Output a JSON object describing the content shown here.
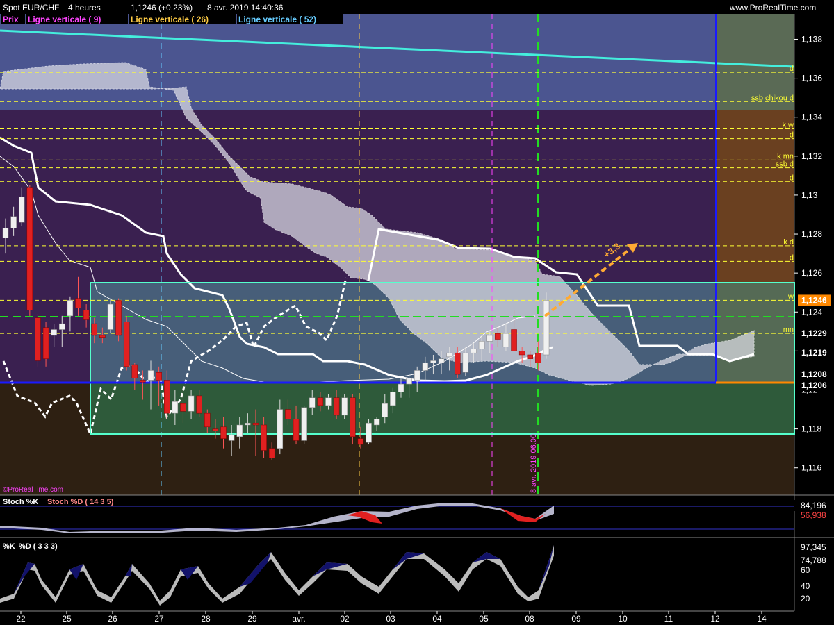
{
  "header": {
    "instrument": "Spot EUR/CHF",
    "timeframe": "4 heures",
    "last": "1,1246 (+0,23%)",
    "datetime": "8 avr. 2019 14:40:36",
    "site": "www.ProRealTime.com",
    "watermark": "©ProRealTime.com"
  },
  "indicators_legend": [
    {
      "label": "Prix",
      "color": "#ff44ff"
    },
    {
      "label": "Ligne verticale ( 9)",
      "color": "#ff44ff"
    },
    {
      "label": "Ligne verticale ( 26)",
      "color": "#ffcc44"
    },
    {
      "label": "Ligne verticale ( 52)",
      "color": "#66ccff"
    }
  ],
  "price_axis": {
    "ticks": [
      "1,138",
      "1,136",
      "1,134",
      "1,132",
      "1,13",
      "1,128",
      "1,126",
      "1,124",
      "1,122",
      "1,12",
      "1,118",
      "1,116"
    ],
    "min": 1.1146,
    "max": 1.1393,
    "highlight": [
      "1,1246",
      "1,1229",
      "1,1219",
      "1,1208",
      "1,1206"
    ]
  },
  "time_axis": [
    "22",
    "25",
    "26",
    "27",
    "28",
    "29",
    "avr.",
    "02",
    "03",
    "04",
    "05",
    "08",
    "09",
    "10",
    "11",
    "12",
    "14"
  ],
  "levels": [
    {
      "label": "d",
      "price": 1.1363
    },
    {
      "label": "ssb chikou d",
      "price": 1.1348
    },
    {
      "label": "k w",
      "price": 1.1334
    },
    {
      "label": "d",
      "price": 1.1329
    },
    {
      "label": "k mn",
      "price": 1.1318
    },
    {
      "label": "ssb d",
      "price": 1.1314
    },
    {
      "label": "d",
      "price": 1.1307
    },
    {
      "label": "k d",
      "price": 1.1274
    },
    {
      "label": "d",
      "price": 1.1266
    },
    {
      "label": "w",
      "price": 1.1246
    },
    {
      "label": "mn",
      "price": 1.1229
    }
  ],
  "annotations": {
    "target_label": "+3,3",
    "vline_label": "8 avr. 2019 06:00"
  },
  "colors": {
    "bull": "#f0f0f0",
    "bear": "#e02020",
    "level": "#ffff33",
    "range_box": "#55ffcc",
    "trend": "#44eedd",
    "accent": "#ff8800"
  },
  "sub1": {
    "name1": "Stoch %K",
    "name2": "Stoch %D ( 14 3 5)",
    "v1": "84,196",
    "v2": "56,938"
  },
  "sub2": {
    "name1": "%K",
    "name2": "%D ( 3 3 3)",
    "v1": "97,345",
    "v2": "74,788",
    "ticks": [
      "60",
      "40",
      "20"
    ]
  },
  "chart_data": {
    "type": "candlestick",
    "title": "Spot EUR/CHF",
    "interval": "4 heures",
    "candles": [
      {
        "o": 1.1278,
        "h": 1.1288,
        "l": 1.127,
        "c": 1.1283
      },
      {
        "o": 1.1283,
        "h": 1.1294,
        "l": 1.1279,
        "c": 1.1289
      },
      {
        "o": 1.1286,
        "h": 1.1304,
        "l": 1.1284,
        "c": 1.1299
      },
      {
        "o": 1.1304,
        "h": 1.1305,
        "l": 1.1238,
        "c": 1.1241
      },
      {
        "o": 1.1237,
        "h": 1.1239,
        "l": 1.1212,
        "c": 1.1215
      },
      {
        "o": 1.1232,
        "h": 1.1235,
        "l": 1.1212,
        "c": 1.1216
      },
      {
        "o": 1.1228,
        "h": 1.1234,
        "l": 1.1222,
        "c": 1.1231
      },
      {
        "o": 1.1231,
        "h": 1.1238,
        "l": 1.1222,
        "c": 1.1234
      },
      {
        "o": 1.1238,
        "h": 1.1248,
        "l": 1.123,
        "c": 1.1246
      },
      {
        "o": 1.1247,
        "h": 1.1258,
        "l": 1.1238,
        "c": 1.1242
      },
      {
        "o": 1.1241,
        "h": 1.1244,
        "l": 1.1232,
        "c": 1.1236
      },
      {
        "o": 1.1234,
        "h": 1.1237,
        "l": 1.1224,
        "c": 1.1228
      },
      {
        "o": 1.1228,
        "h": 1.1232,
        "l": 1.1224,
        "c": 1.1227
      },
      {
        "o": 1.1231,
        "h": 1.1247,
        "l": 1.1229,
        "c": 1.1244
      },
      {
        "o": 1.1246,
        "h": 1.1247,
        "l": 1.1225,
        "c": 1.1228
      },
      {
        "o": 1.1235,
        "h": 1.1238,
        "l": 1.121,
        "c": 1.1212
      },
      {
        "o": 1.1213,
        "h": 1.1214,
        "l": 1.12,
        "c": 1.1206
      },
      {
        "o": 1.1205,
        "h": 1.121,
        "l": 1.1195,
        "c": 1.1204
      },
      {
        "o": 1.1205,
        "h": 1.1215,
        "l": 1.119,
        "c": 1.121
      },
      {
        "o": 1.1209,
        "h": 1.1212,
        "l": 1.1192,
        "c": 1.1205
      },
      {
        "o": 1.1205,
        "h": 1.121,
        "l": 1.1185,
        "c": 1.1188
      },
      {
        "o": 1.1188,
        "h": 1.12,
        "l": 1.1182,
        "c": 1.1194
      },
      {
        "o": 1.1193,
        "h": 1.12,
        "l": 1.1183,
        "c": 1.1189
      },
      {
        "o": 1.1189,
        "h": 1.12,
        "l": 1.1185,
        "c": 1.1197
      },
      {
        "o": 1.1197,
        "h": 1.12,
        "l": 1.1186,
        "c": 1.1188
      },
      {
        "o": 1.1188,
        "h": 1.119,
        "l": 1.1178,
        "c": 1.1181
      },
      {
        "o": 1.118,
        "h": 1.1185,
        "l": 1.1175,
        "c": 1.1179
      },
      {
        "o": 1.1181,
        "h": 1.1186,
        "l": 1.117,
        "c": 1.1175
      },
      {
        "o": 1.1174,
        "h": 1.1182,
        "l": 1.1166,
        "c": 1.1177
      },
      {
        "o": 1.1176,
        "h": 1.1186,
        "l": 1.117,
        "c": 1.1182
      },
      {
        "o": 1.1182,
        "h": 1.1188,
        "l": 1.1178,
        "c": 1.1183
      },
      {
        "o": 1.1183,
        "h": 1.119,
        "l": 1.1166,
        "c": 1.1182
      },
      {
        "o": 1.1182,
        "h": 1.1186,
        "l": 1.1165,
        "c": 1.1169
      },
      {
        "o": 1.117,
        "h": 1.1173,
        "l": 1.1164,
        "c": 1.1165
      },
      {
        "o": 1.117,
        "h": 1.1195,
        "l": 1.1167,
        "c": 1.119
      },
      {
        "o": 1.119,
        "h": 1.1195,
        "l": 1.1182,
        "c": 1.1185
      },
      {
        "o": 1.1185,
        "h": 1.1192,
        "l": 1.1172,
        "c": 1.1174
      },
      {
        "o": 1.1174,
        "h": 1.1192,
        "l": 1.1172,
        "c": 1.1191
      },
      {
        "o": 1.1191,
        "h": 1.12,
        "l": 1.1187,
        "c": 1.1196
      },
      {
        "o": 1.1196,
        "h": 1.1199,
        "l": 1.1189,
        "c": 1.1192
      },
      {
        "o": 1.1192,
        "h": 1.1198,
        "l": 1.119,
        "c": 1.1196
      },
      {
        "o": 1.1196,
        "h": 1.12,
        "l": 1.1185,
        "c": 1.1187
      },
      {
        "o": 1.1187,
        "h": 1.1198,
        "l": 1.1185,
        "c": 1.1196
      },
      {
        "o": 1.1196,
        "h": 1.1198,
        "l": 1.1172,
        "c": 1.1176
      },
      {
        "o": 1.1175,
        "h": 1.1181,
        "l": 1.117,
        "c": 1.1172
      },
      {
        "o": 1.1173,
        "h": 1.1185,
        "l": 1.1172,
        "c": 1.1183
      },
      {
        "o": 1.1182,
        "h": 1.1186,
        "l": 1.1179,
        "c": 1.1185
      },
      {
        "o": 1.1186,
        "h": 1.1198,
        "l": 1.1183,
        "c": 1.1193
      },
      {
        "o": 1.1192,
        "h": 1.1201,
        "l": 1.1188,
        "c": 1.1199
      },
      {
        "o": 1.1199,
        "h": 1.1206,
        "l": 1.1196,
        "c": 1.1203
      },
      {
        "o": 1.1203,
        "h": 1.1207,
        "l": 1.1196,
        "c": 1.1206
      },
      {
        "o": 1.1205,
        "h": 1.1212,
        "l": 1.1199,
        "c": 1.121
      },
      {
        "o": 1.121,
        "h": 1.1217,
        "l": 1.1205,
        "c": 1.1214
      },
      {
        "o": 1.1214,
        "h": 1.1218,
        "l": 1.1208,
        "c": 1.1215
      },
      {
        "o": 1.1214,
        "h": 1.122,
        "l": 1.1208,
        "c": 1.1216
      },
      {
        "o": 1.1217,
        "h": 1.1222,
        "l": 1.121,
        "c": 1.1219
      },
      {
        "o": 1.1219,
        "h": 1.1222,
        "l": 1.1206,
        "c": 1.1208
      },
      {
        "o": 1.1209,
        "h": 1.1222,
        "l": 1.1207,
        "c": 1.1219
      },
      {
        "o": 1.1219,
        "h": 1.1224,
        "l": 1.1214,
        "c": 1.1221
      },
      {
        "o": 1.1221,
        "h": 1.1228,
        "l": 1.1215,
        "c": 1.1225
      },
      {
        "o": 1.1225,
        "h": 1.123,
        "l": 1.1219,
        "c": 1.1228
      },
      {
        "o": 1.1229,
        "h": 1.1232,
        "l": 1.1222,
        "c": 1.1226
      },
      {
        "o": 1.1222,
        "h": 1.1234,
        "l": 1.122,
        "c": 1.1229
      },
      {
        "o": 1.1231,
        "h": 1.1241,
        "l": 1.122,
        "c": 1.122
      },
      {
        "o": 1.122,
        "h": 1.1222,
        "l": 1.1214,
        "c": 1.1218
      },
      {
        "o": 1.1218,
        "h": 1.122,
        "l": 1.1212,
        "c": 1.1216
      },
      {
        "o": 1.1219,
        "h": 1.1225,
        "l": 1.121,
        "c": 1.1214
      },
      {
        "o": 1.1218,
        "h": 1.125,
        "l": 1.1216,
        "c": 1.1246
      }
    ],
    "ylim": [
      1.1146,
      1.1393
    ]
  }
}
